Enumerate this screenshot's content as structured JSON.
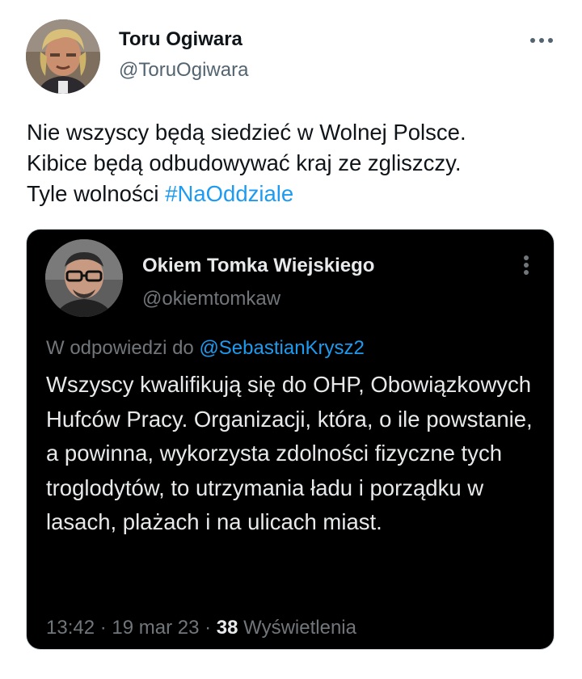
{
  "tweet": {
    "author": {
      "display_name": "Toru Ogiwara",
      "handle": "@ToruOgiwara",
      "avatar_icon": "user-avatar-photo"
    },
    "more_icon": "more-horizontal-icon",
    "text_parts": {
      "line1": "Nie wszyscy będą siedzieć w Wolnej Polsce.",
      "line2": "Kibice będą odbudowywać kraj ze zgliszczy.",
      "line3_prefix": "Tyle wolności ",
      "hashtag": "#NaOddziale"
    }
  },
  "quoted_tweet": {
    "author": {
      "display_name": "Okiem Tomka Wiejskiego",
      "handle": "@okiemtomkaw",
      "avatar_icon": "user-avatar-photo"
    },
    "more_icon": "more-vertical-icon",
    "reply_prefix": "W odpowiedzi do ",
    "reply_mention": "@SebastianKrysz2",
    "text": "Wszyscy kwalifikują się do OHP, Obowiązkowych Hufców Pracy. Organizacji, która, o ile powstanie, a powinna, wykorzysta zdolności fizyczne tych troglodytów, to utrzymania ładu i porządku w lasach, plażach i na ulicach miast.",
    "meta": {
      "time": "13:42",
      "separator": " · ",
      "date": "19 mar 23",
      "views_count": "38",
      "views_label": " Wyświetlenia"
    }
  },
  "colors": {
    "text_primary": "#0f1419",
    "text_secondary": "#536471",
    "link": "#1d9bf0",
    "card_bg": "#000000",
    "card_text": "#e7e9ea",
    "card_secondary": "#71767b"
  }
}
